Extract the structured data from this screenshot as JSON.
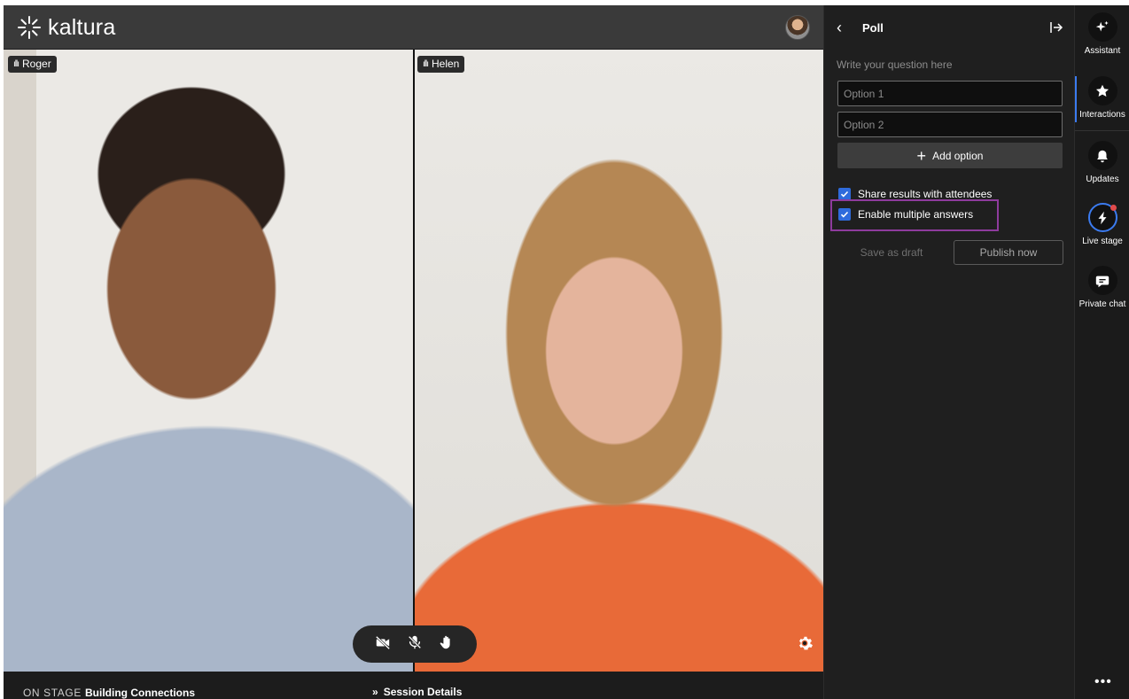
{
  "app": {
    "logo_text": "kaltura"
  },
  "participants": [
    {
      "name": "Roger"
    },
    {
      "name": "Helen"
    }
  ],
  "footer": {
    "on_stage_label": "ON STAGE",
    "session_title": "Building Connections",
    "session_details_label": "Session Details"
  },
  "poll": {
    "title": "Poll",
    "question_placeholder": "Write your question here",
    "options": [
      {
        "placeholder": "Option 1"
      },
      {
        "placeholder": "Option 2"
      }
    ],
    "add_option_label": "Add option",
    "share_results_label": "Share results with attendees",
    "share_results_checked": true,
    "multiple_answers_label": "Enable multiple answers",
    "multiple_answers_checked": true,
    "save_draft_label": "Save as draft",
    "publish_label": "Publish now"
  },
  "rail": {
    "items": [
      {
        "label": "Assistant",
        "icon": "sparkle-icon"
      },
      {
        "label": "Interactions",
        "icon": "star-icon",
        "active": true
      },
      {
        "label": "Updates",
        "icon": "bell-icon"
      },
      {
        "label": "Live stage",
        "icon": "lightning-icon",
        "notification": true
      },
      {
        "label": "Private chat",
        "icon": "chat-icon"
      }
    ],
    "more_label": "•••"
  },
  "colors": {
    "accent": "#3b7bf0",
    "checkbox": "#2f6bdc",
    "highlight": "#8e3b9d",
    "notification": "#e24b4b"
  }
}
